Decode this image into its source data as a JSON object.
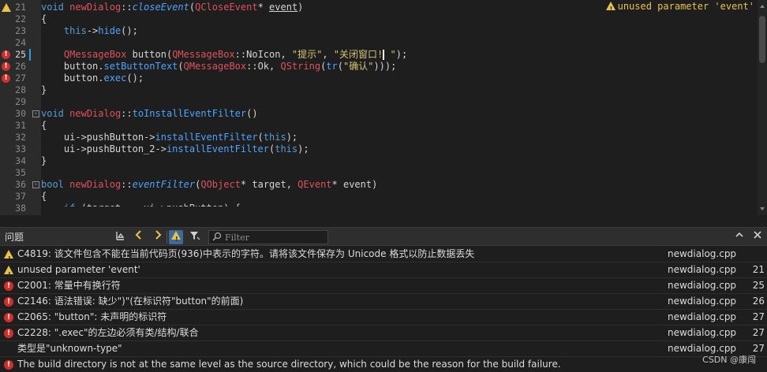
{
  "editor": {
    "inline_warning": "unused parameter 'event'",
    "lines": [
      {
        "num": "21",
        "marker": "warning",
        "current": false,
        "tokens": [
          {
            "t": "void",
            "c": "t-kw"
          },
          {
            "t": " ",
            "c": "t-pl"
          },
          {
            "t": "newDialog",
            "c": "t-kwm"
          },
          {
            "t": "::",
            "c": "t-pl"
          },
          {
            "t": "closeEvent",
            "c": "t-fni"
          },
          {
            "t": "(",
            "c": "t-pl"
          },
          {
            "t": "QCloseEvent",
            "c": "t-cls"
          },
          {
            "t": "* ",
            "c": "t-pl"
          },
          {
            "t": "event",
            "c": "t-ul"
          },
          {
            "t": ")",
            "c": "t-pl"
          }
        ]
      },
      {
        "num": "22",
        "marker": "",
        "current": false,
        "tokens": [
          {
            "t": "{",
            "c": "t-pl"
          }
        ]
      },
      {
        "num": "23",
        "marker": "",
        "current": false,
        "tokens": [
          {
            "t": "    ",
            "c": "t-pl"
          },
          {
            "t": "this",
            "c": "t-kw"
          },
          {
            "t": "->",
            "c": "t-pl"
          },
          {
            "t": "hide",
            "c": "t-fn"
          },
          {
            "t": "();",
            "c": "t-pl"
          }
        ]
      },
      {
        "num": "24",
        "marker": "",
        "current": false,
        "tokens": []
      },
      {
        "num": "25",
        "marker": "error",
        "current": true,
        "tokens": [
          {
            "t": "    ",
            "c": "t-pl"
          },
          {
            "t": "QMessageBox",
            "c": "t-cls"
          },
          {
            "t": " button(",
            "c": "t-pl"
          },
          {
            "t": "QMessageBox",
            "c": "t-cls"
          },
          {
            "t": "::NoIcon, ",
            "c": "t-pl"
          },
          {
            "t": "\"提示\"",
            "c": "t-str"
          },
          {
            "t": ", ",
            "c": "t-pl"
          },
          {
            "t": "\"关闭窗口!",
            "c": "t-str"
          },
          {
            "t": "CARET",
            "c": "caret"
          },
          {
            "t": " \"",
            "c": "t-str"
          },
          {
            "t": ");",
            "c": "t-pl"
          }
        ]
      },
      {
        "num": "26",
        "marker": "error",
        "current": false,
        "tokens": [
          {
            "t": "    button.",
            "c": "t-pl"
          },
          {
            "t": "setButtonText",
            "c": "t-fn"
          },
          {
            "t": "(",
            "c": "t-pl"
          },
          {
            "t": "QMessageBox",
            "c": "t-cls"
          },
          {
            "t": "::Ok, ",
            "c": "t-pl"
          },
          {
            "t": "QString",
            "c": "t-cls"
          },
          {
            "t": "(",
            "c": "t-pl"
          },
          {
            "t": "tr",
            "c": "t-fn"
          },
          {
            "t": "(",
            "c": "t-pl"
          },
          {
            "t": "\"确认\"",
            "c": "t-str"
          },
          {
            "t": ")));",
            "c": "t-pl"
          }
        ]
      },
      {
        "num": "27",
        "marker": "error",
        "current": false,
        "tokens": [
          {
            "t": "    button.",
            "c": "t-pl"
          },
          {
            "t": "exec",
            "c": "t-fn"
          },
          {
            "t": "();",
            "c": "t-pl"
          }
        ]
      },
      {
        "num": "28",
        "marker": "",
        "current": false,
        "tokens": [
          {
            "t": "}",
            "c": "t-pl"
          }
        ]
      },
      {
        "num": "29",
        "marker": "",
        "current": false,
        "tokens": []
      },
      {
        "num": "30",
        "marker": "",
        "current": false,
        "fold": true,
        "tokens": [
          {
            "t": "void",
            "c": "t-kw"
          },
          {
            "t": " ",
            "c": "t-pl"
          },
          {
            "t": "newDialog",
            "c": "t-kwm"
          },
          {
            "t": "::",
            "c": "t-pl"
          },
          {
            "t": "toInstallEventFilter",
            "c": "t-fn"
          },
          {
            "t": "()",
            "c": "t-pl"
          }
        ]
      },
      {
        "num": "31",
        "marker": "",
        "current": false,
        "tokens": [
          {
            "t": "{",
            "c": "t-pl"
          }
        ]
      },
      {
        "num": "32",
        "marker": "",
        "current": false,
        "tokens": [
          {
            "t": "    ui->pushButton->",
            "c": "t-pl"
          },
          {
            "t": "installEventFilter",
            "c": "t-fn"
          },
          {
            "t": "(",
            "c": "t-pl"
          },
          {
            "t": "this",
            "c": "t-kw"
          },
          {
            "t": ");",
            "c": "t-pl"
          }
        ]
      },
      {
        "num": "33",
        "marker": "",
        "current": false,
        "tokens": [
          {
            "t": "    ui->pushButton_2->",
            "c": "t-pl"
          },
          {
            "t": "installEventFilter",
            "c": "t-fn"
          },
          {
            "t": "(",
            "c": "t-pl"
          },
          {
            "t": "this",
            "c": "t-kw"
          },
          {
            "t": ");",
            "c": "t-pl"
          }
        ]
      },
      {
        "num": "34",
        "marker": "",
        "current": false,
        "tokens": [
          {
            "t": "}",
            "c": "t-pl"
          }
        ]
      },
      {
        "num": "35",
        "marker": "",
        "current": false,
        "tokens": []
      },
      {
        "num": "36",
        "marker": "",
        "current": false,
        "fold": true,
        "tokens": [
          {
            "t": "bool",
            "c": "t-kw"
          },
          {
            "t": " ",
            "c": "t-pl"
          },
          {
            "t": "newDialog",
            "c": "t-kwm"
          },
          {
            "t": "::",
            "c": "t-pl"
          },
          {
            "t": "eventFilter",
            "c": "t-fni"
          },
          {
            "t": "(",
            "c": "t-pl"
          },
          {
            "t": "QObject",
            "c": "t-cls"
          },
          {
            "t": "* target, ",
            "c": "t-pl"
          },
          {
            "t": "QEvent",
            "c": "t-cls"
          },
          {
            "t": "* event)",
            "c": "t-pl"
          }
        ]
      },
      {
        "num": "37",
        "marker": "",
        "current": false,
        "tokens": [
          {
            "t": "{",
            "c": "t-pl"
          }
        ]
      },
      {
        "num": "38",
        "marker": "",
        "current": false,
        "tokens": [
          {
            "t": "    ",
            "c": "t-pl"
          },
          {
            "t": "if",
            "c": "t-kw"
          },
          {
            "t": " (target == ui->pushButton) {",
            "c": "t-pl"
          }
        ]
      }
    ]
  },
  "issues_panel": {
    "title": "问题",
    "filter_placeholder": "Filter",
    "items": [
      {
        "type": "warning",
        "message": "C4819: 该文件包含不能在当前代码页(936)中表示的字符。请将该文件保存为 Unicode 格式以防止数据丢失",
        "file": "newdialog.cpp",
        "line": ""
      },
      {
        "type": "warning",
        "message": "unused parameter 'event'",
        "file": "newdialog.cpp",
        "line": "21"
      },
      {
        "type": "error",
        "message": "C2001: 常量中有换行符",
        "file": "newdialog.cpp",
        "line": "25"
      },
      {
        "type": "error",
        "message": "C2146: 语法错误: 缺少\")\"(在标识符\"button\"的前面)",
        "file": "newdialog.cpp",
        "line": "26"
      },
      {
        "type": "error",
        "message": "C2065: \"button\": 未声明的标识符",
        "file": "newdialog.cpp",
        "line": "27"
      },
      {
        "type": "error",
        "message": "C2228: \".exec\"的左边必须有类/结构/联合",
        "file": "newdialog.cpp",
        "line": "27"
      },
      {
        "type": "none",
        "message": "类型是\"unknown-type\"",
        "file": "newdialog.cpp",
        "line": "27"
      },
      {
        "type": "error",
        "message": "The build directory is not at the same level as the source directory, which could be the reason for the build failure.",
        "file": "",
        "line": ""
      }
    ]
  },
  "watermark": "CSDN @康闯"
}
